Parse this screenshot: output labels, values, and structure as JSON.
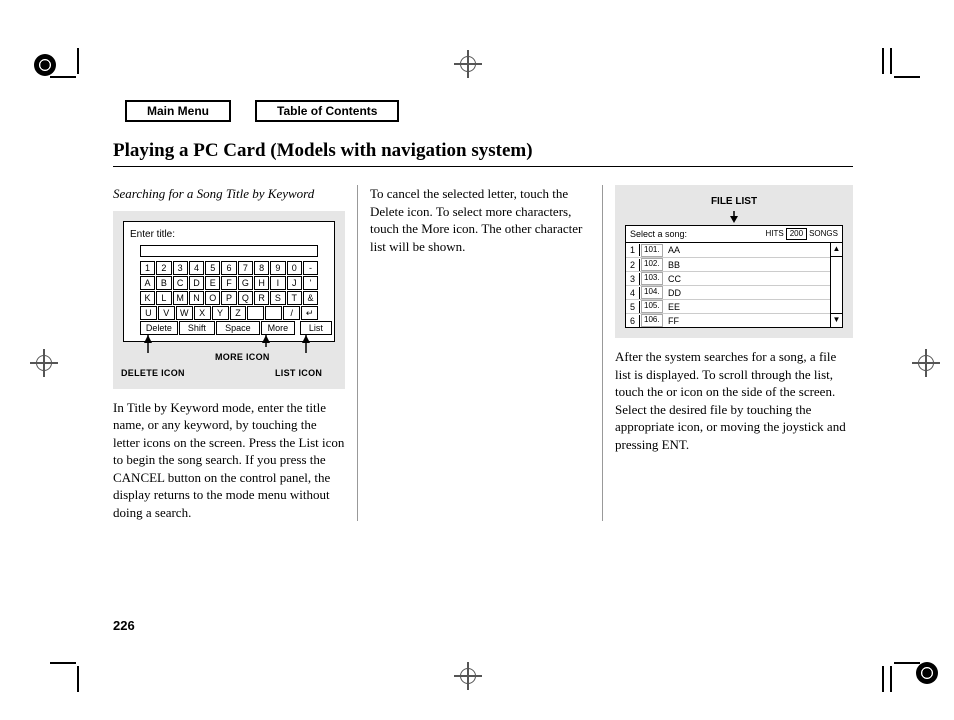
{
  "nav": {
    "main_menu": "Main Menu",
    "toc": "Table of Contents"
  },
  "title": "Playing a PC Card (Models with navigation system)",
  "page_number": "226",
  "col1": {
    "subhead": "Searching for a Song Title by Keyword",
    "kbd": {
      "prompt": "Enter title:",
      "row1": [
        "1",
        "2",
        "3",
        "4",
        "5",
        "6",
        "7",
        "8",
        "9",
        "0",
        "-"
      ],
      "row2": [
        "A",
        "B",
        "C",
        "D",
        "E",
        "F",
        "G",
        "H",
        "I",
        "J",
        "'"
      ],
      "row3": [
        "K",
        "L",
        "M",
        "N",
        "O",
        "P",
        "Q",
        "R",
        "S",
        "T",
        "&"
      ],
      "row4": [
        "U",
        "V",
        "W",
        "X",
        "Y",
        "Z",
        " ",
        " ",
        "/",
        "↵"
      ],
      "ctrl": {
        "delete": "Delete",
        "shift": "Shift",
        "space": "Space",
        "more": "More",
        "list": "List"
      }
    },
    "ann": {
      "delete": "DELETE ICON",
      "more": "MORE ICON",
      "list": "LIST ICON"
    },
    "body": "In Title by Keyword mode, enter the title name, or any keyword, by touching the letter icons on the screen. Press the List icon to begin the song search. If you press the CANCEL button on the control panel, the display returns to the mode menu without doing a search."
  },
  "col2": {
    "body": "To cancel the selected letter, touch the Delete icon. To select more characters, touch the More icon. The other character list will be shown."
  },
  "col3": {
    "fl": {
      "title": "FILE LIST",
      "select": "Select a song:",
      "hits_pre": "HITS",
      "hits_count": "200",
      "hits_post": "SONGS",
      "rows": [
        {
          "i": "1",
          "n": "101.",
          "name": "AA"
        },
        {
          "i": "2",
          "n": "102.",
          "name": "BB"
        },
        {
          "i": "3",
          "n": "103.",
          "name": "CC"
        },
        {
          "i": "4",
          "n": "104.",
          "name": "DD"
        },
        {
          "i": "5",
          "n": "105.",
          "name": "EE"
        },
        {
          "i": "6",
          "n": "106.",
          "name": "FF"
        }
      ],
      "up": "▲",
      "down": "▼"
    },
    "body": "After the system searches for a song, a file list is displayed. To scroll through the list, touch the      or      icon on the side of the screen. Select the desired file by touching the appropriate icon, or moving the joystick and pressing ENT."
  }
}
